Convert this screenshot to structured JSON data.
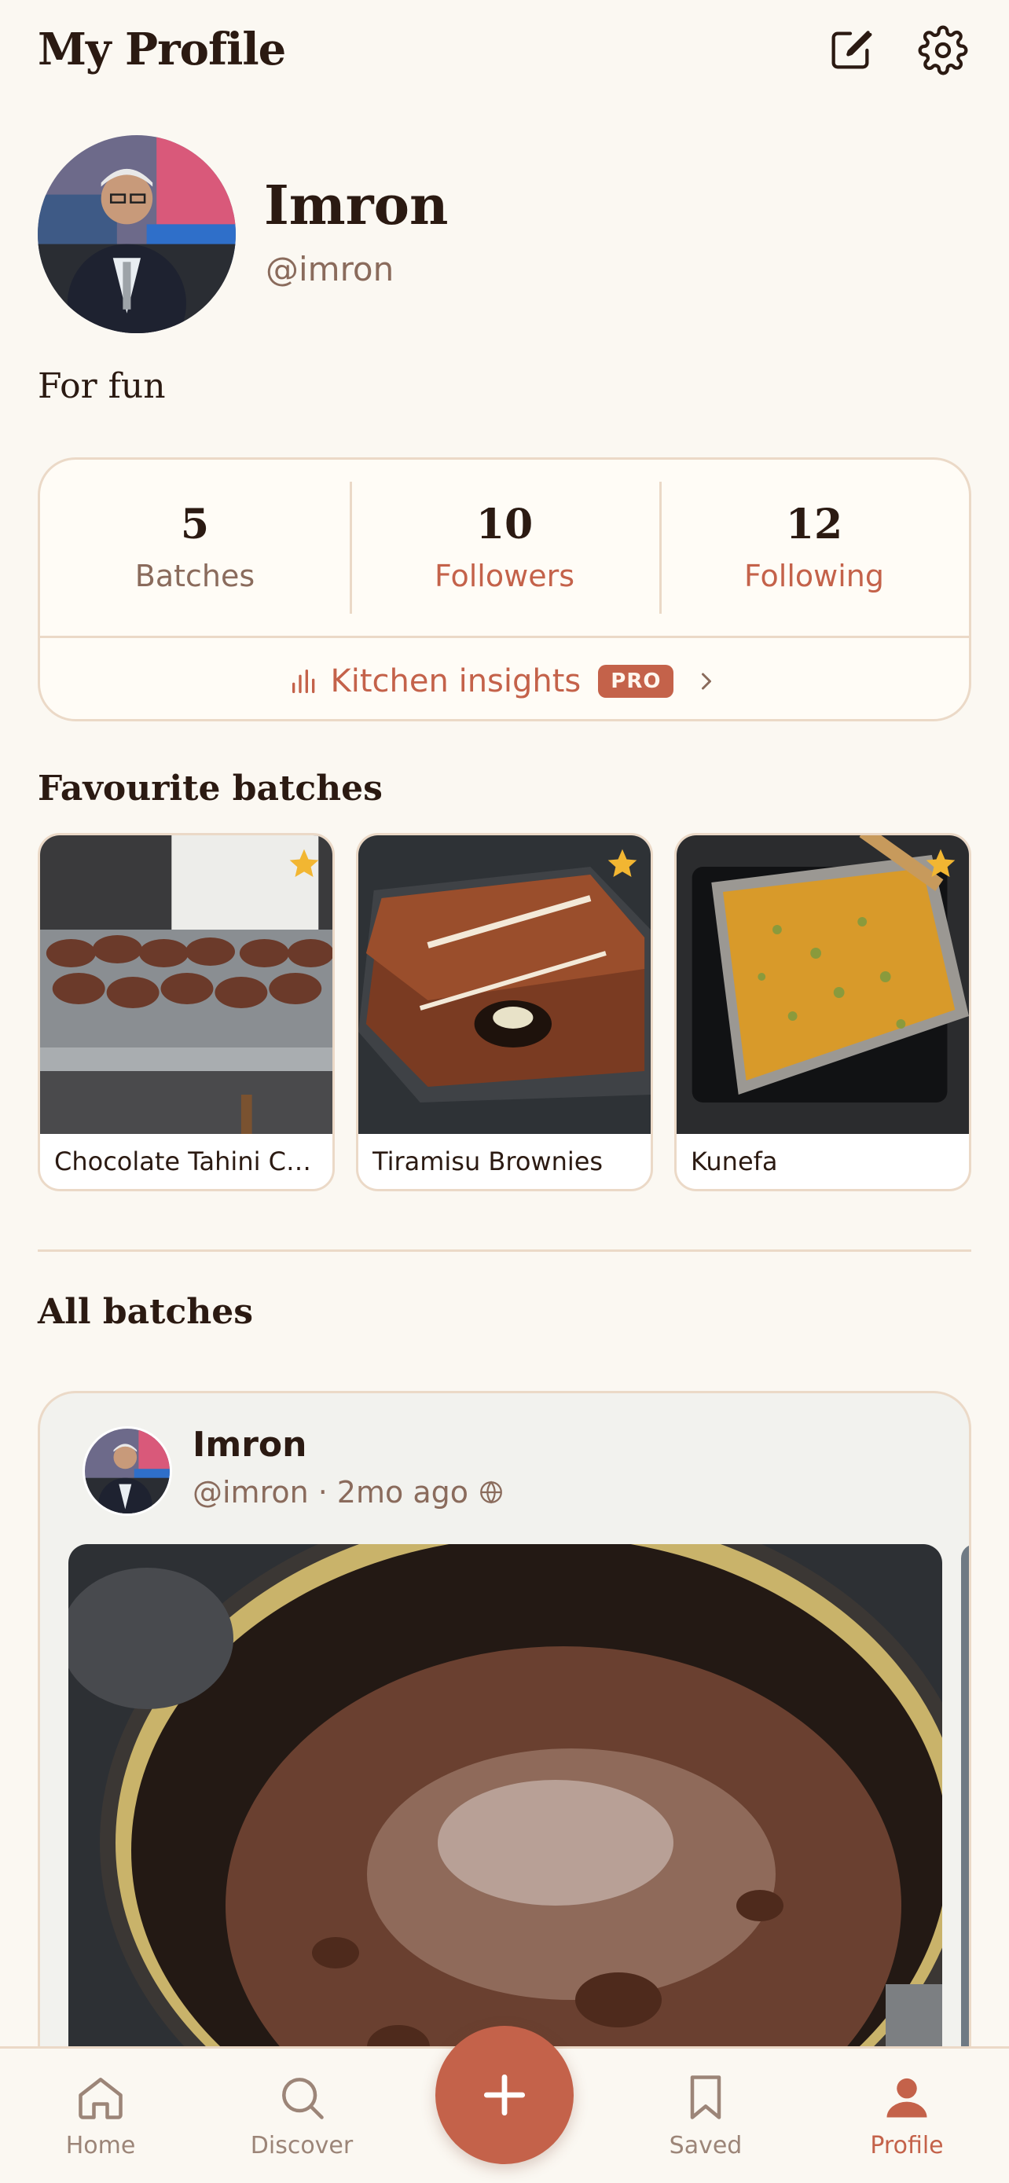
{
  "header": {
    "title": "My Profile",
    "edit_icon": "edit-icon",
    "settings_icon": "gear-icon"
  },
  "profile": {
    "display_name": "Imron",
    "handle": "@imron",
    "bio": "For fun"
  },
  "stats": {
    "batches": {
      "value": "5",
      "label": "Batches"
    },
    "followers": {
      "value": "10",
      "label": "Followers"
    },
    "following": {
      "value": "12",
      "label": "Following"
    },
    "insights_label": "Kitchen insights",
    "insights_badge": "PRO"
  },
  "favourites": {
    "title": "Favourite batches",
    "items": [
      {
        "title": "Chocolate Tahini Co..."
      },
      {
        "title": "Tiramisu Brownies"
      },
      {
        "title": "Kunefa"
      }
    ]
  },
  "all_batches": {
    "title": "All batches",
    "post": {
      "name": "Imron",
      "handle": "@imron",
      "separator": "·",
      "time": "2mo ago",
      "visibility_icon": "globe-icon"
    }
  },
  "nav": {
    "home": "Home",
    "discover": "Discover",
    "saved": "Saved",
    "profile": "Profile",
    "active": "profile"
  },
  "colors": {
    "background": "#FBF8F2",
    "accent": "#C4624A",
    "border": "#EBD9C7",
    "text": "#2B1A12",
    "muted": "#8A6B5C",
    "star": "#F2B632"
  }
}
